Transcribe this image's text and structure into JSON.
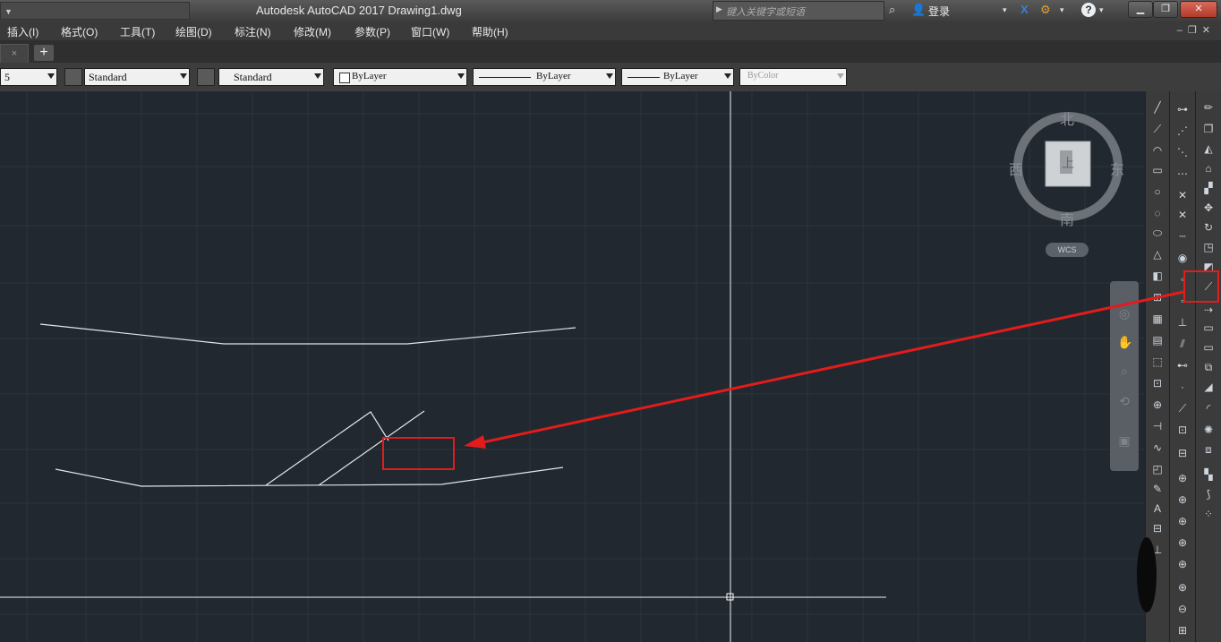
{
  "titlebar": {
    "app_title": "Autodesk AutoCAD 2017    Drawing1.dwg",
    "search_placeholder": "键入关键字或短语",
    "login_label": "登录",
    "help_label": "?"
  },
  "menu": {
    "items": [
      "插入(I)",
      "格式(O)",
      "工具(T)",
      "绘图(D)",
      "标注(N)",
      "修改(M)",
      "参数(P)",
      "窗口(W)",
      "帮助(H)"
    ]
  },
  "tabs": {
    "doc_tab_label": "×",
    "new_tab_label": "+"
  },
  "properties": {
    "first_combo_value": "5",
    "text_style": "Standard",
    "dim_style": "Standard",
    "color": "ByLayer",
    "linetype": "ByLayer",
    "lineweight": "ByLayer",
    "plot_style": "ByColor"
  },
  "viewcube": {
    "north": "北",
    "south": "南",
    "east": "东",
    "west": "西",
    "face_label": "上",
    "wcs_label": "WCS"
  },
  "colors": {
    "canvas_bg": "#212830",
    "annotation_red": "#e21c1c",
    "drawing_line": "#e6e6e6"
  },
  "icons": {
    "toolbar_1": [
      "line-icon",
      "polyline-icon",
      "arc-icon",
      "rectangle-icon",
      "circle-icon",
      "revision-cloud-icon",
      "ellipse-icon",
      "construction-line-icon",
      "insert-block-icon",
      "table-icon",
      "hatch-icon",
      "gradient-icon",
      "region-icon",
      "point-icon",
      "dimension-icon",
      "text-icon",
      "multiline-text-icon"
    ],
    "toolbar_2": [
      "dim-linear-icon",
      "dim-aligned-icon",
      "dim-arc-icon",
      "dim-ordinate-icon",
      "dim-radius-icon",
      "dim-jogged-icon",
      "dim-diameter-icon",
      "dim-angular-icon",
      "quick-dim-icon",
      "baseline-icon",
      "continue-icon",
      "tolerance-icon",
      "center-mark-icon",
      "dim-edit-icon",
      "dim-update-icon",
      "zoom-icon",
      "pan-icon"
    ],
    "toolbar_3": [
      "erase-icon",
      "copy-icon",
      "mirror-icon",
      "offset-icon",
      "array-icon",
      "move-icon",
      "rotate-icon",
      "scale-icon",
      "stretch-icon",
      "trim-icon",
      "extend-icon",
      "break-icon",
      "join-icon",
      "chamfer-icon",
      "fillet-icon",
      "explode-icon"
    ]
  }
}
